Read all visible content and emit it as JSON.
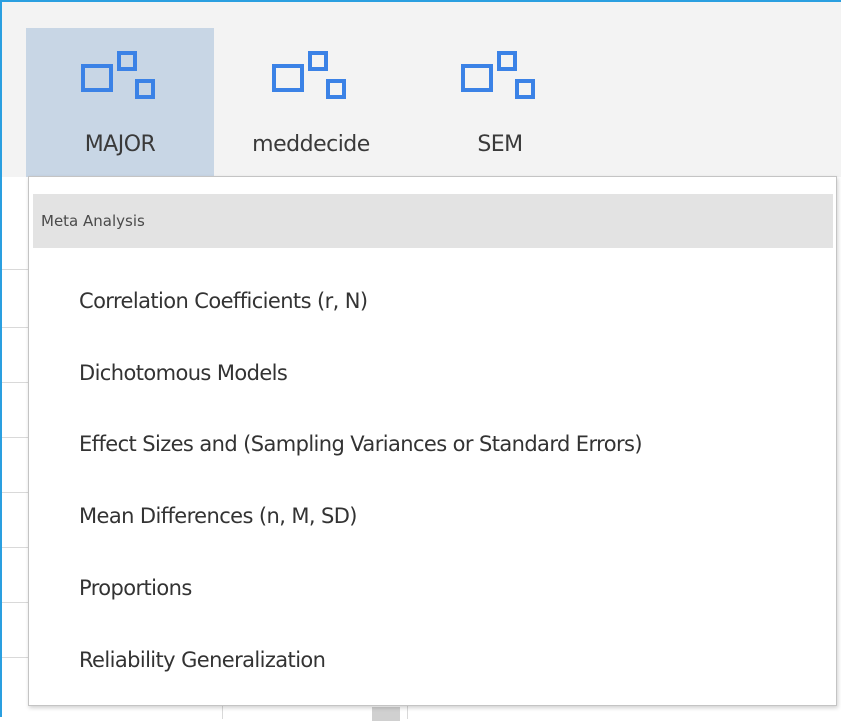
{
  "toolbar": {
    "buttons": [
      {
        "label": "MAJOR",
        "active": true
      },
      {
        "label": "meddecide",
        "active": false
      },
      {
        "label": "SEM",
        "active": false
      }
    ],
    "icon": "modules-icon",
    "icon_color": "#3b82e6"
  },
  "menu": {
    "header": "Meta Analysis",
    "items": [
      {
        "label": "Correlation Coefficients (r, N)"
      },
      {
        "label": "Dichotomous Models"
      },
      {
        "label": "Effect Sizes and (Sampling Variances or Standard Errors)"
      },
      {
        "label": "Mean Differences (n, M, SD)"
      },
      {
        "label": "Proportions"
      },
      {
        "label": "Reliability Generalization"
      }
    ]
  },
  "colors": {
    "accent": "#2a9fe0",
    "active_button": "#c8d6e5",
    "header_bg": "#e3e3e3"
  }
}
